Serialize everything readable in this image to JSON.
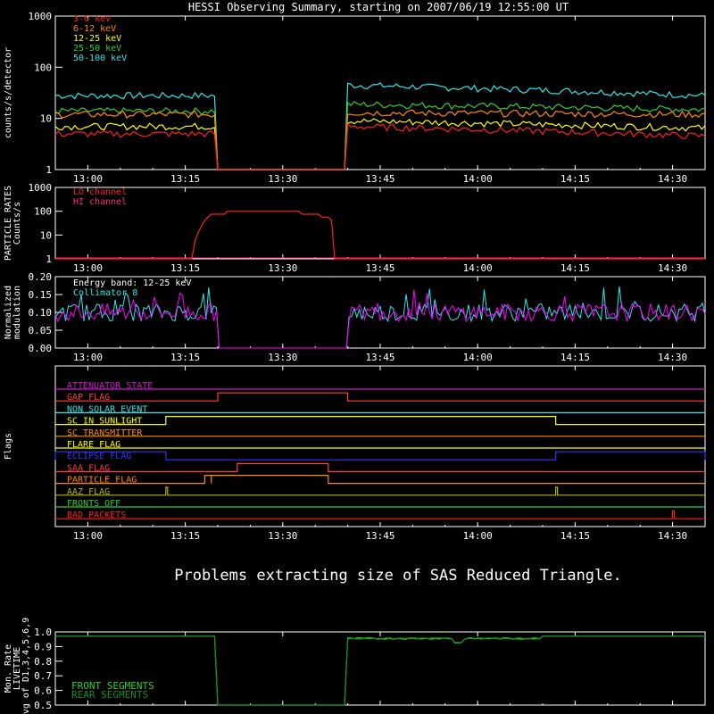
{
  "title": "HESSI Observing Summary, starting on 2007/06/19 12:55:00 UT",
  "x_ticks": [
    "13:00",
    "13:15",
    "13:30",
    "13:45",
    "14:00",
    "14:15",
    "14:30"
  ],
  "message": "Problems extracting size of SAS Reduced Triangle.",
  "chart_data": [
    {
      "type": "line",
      "ylabel": "counts/s/detector",
      "yscale": "log",
      "ylim": [
        1,
        1000
      ],
      "y_ticks": [
        "1",
        "10",
        "100",
        "1000"
      ],
      "x_range": [
        "12:55",
        "14:35"
      ],
      "gap": [
        "13:20",
        "13:40"
      ],
      "series": [
        {
          "name": "3-6 keV",
          "color": "#ff1e1e",
          "before": 5,
          "after_start": 7,
          "after_end": 4.5
        },
        {
          "name": "6-12 keV",
          "color": "#ff8c00",
          "before": 12,
          "after_start": 13,
          "after_end": 12
        },
        {
          "name": "12-25 keV",
          "color": "#ffff00",
          "before": 7,
          "after_start": 9,
          "after_end": 6.5
        },
        {
          "name": "25-50 keV",
          "color": "#32cd32",
          "before": 14,
          "after_start": 19,
          "after_end": 15
        },
        {
          "name": "50-100 keV",
          "color": "#32e6e6",
          "before": 28,
          "after_start": 45,
          "after_end": 28
        }
      ]
    },
    {
      "type": "line",
      "ylabel": "PARTICLE RATES Counts/s",
      "yscale": "log",
      "ylim": [
        1,
        1000
      ],
      "y_ticks": [
        "1",
        "10",
        "100",
        "1000"
      ],
      "series": [
        {
          "name": "LO channel",
          "color": "#ff1e1e",
          "peak": 100,
          "start": "13:16",
          "end": "13:38"
        },
        {
          "name": "HI channel",
          "color": "#ff2a7a",
          "peak": 1,
          "start": "13:16",
          "end": "13:38"
        }
      ]
    },
    {
      "type": "line",
      "ylabel": "Normalized modulation",
      "ylim": [
        0,
        0.2
      ],
      "y_ticks": [
        "0.00",
        "0.05",
        "0.10",
        "0.15",
        "0.20"
      ],
      "annotation": "Energy band: 12-25 keV",
      "series": [
        {
          "name": "Collimator 8",
          "color": "#32e6e6",
          "mean": 0.1
        },
        {
          "name": "",
          "color": "#ff00ff",
          "mean": 0.1
        }
      ]
    },
    {
      "type": "table",
      "ylabel": "Flags",
      "flags": [
        {
          "name": "ATTENUATOR STATE",
          "color": "#c81ec8",
          "on": []
        },
        {
          "name": "GAP FLAG",
          "color": "#ff4040",
          "on": [
            [
              "13:20",
              "13:40"
            ]
          ]
        },
        {
          "name": "NON SOLAR EVENT",
          "color": "#32e6e6",
          "on": []
        },
        {
          "name": "SC IN SUNLIGHT",
          "color": "#ffff00",
          "on": [
            [
              "13:12",
              "14:12"
            ]
          ]
        },
        {
          "name": "SC TRANSMITTER",
          "color": "#ff8c00",
          "on": []
        },
        {
          "name": "FLARE FLAG",
          "color": "#ffff00",
          "on": []
        },
        {
          "name": "ECLIPSE FLAG",
          "color": "#3232ff",
          "on": [
            [
              "12:55",
              "13:12"
            ],
            [
              "14:12",
              "14:35"
            ]
          ]
        },
        {
          "name": "SAA FLAG",
          "color": "#ff4040",
          "on": [
            [
              "13:23",
              "13:37"
            ]
          ]
        },
        {
          "name": "PARTICLE FLAG",
          "color": "#ff8c00",
          "on": [
            [
              "13:18",
              "13:19"
            ],
            [
              "13:19",
              "13:37"
            ]
          ]
        },
        {
          "name": "AAZ FLAG",
          "color": "#b4b400",
          "on": [
            [
              "13:12",
              "13:12"
            ],
            [
              "14:12",
              "14:12"
            ]
          ]
        },
        {
          "name": "FRONTS OFF",
          "color": "#32cd32",
          "on": []
        },
        {
          "name": "BAD PACKETS",
          "color": "#ff1e1e",
          "on": [
            [
              "14:30",
              "14:30"
            ]
          ]
        }
      ]
    },
    {
      "type": "line",
      "ylabel": "Mon. Rate LIVETIME avg of D1,3,4,5,6,9",
      "ylim": [
        0.5,
        1.0
      ],
      "y_ticks": [
        "0.5",
        "0.6",
        "0.7",
        "0.8",
        "0.9",
        "1.0"
      ],
      "series": [
        {
          "name": "FRONT SEGMENTS",
          "color": "#32cd32",
          "value": 0.97
        },
        {
          "name": "REAR SEGMENTS",
          "color": "#1e8c1e",
          "value": 0.97
        }
      ]
    }
  ]
}
